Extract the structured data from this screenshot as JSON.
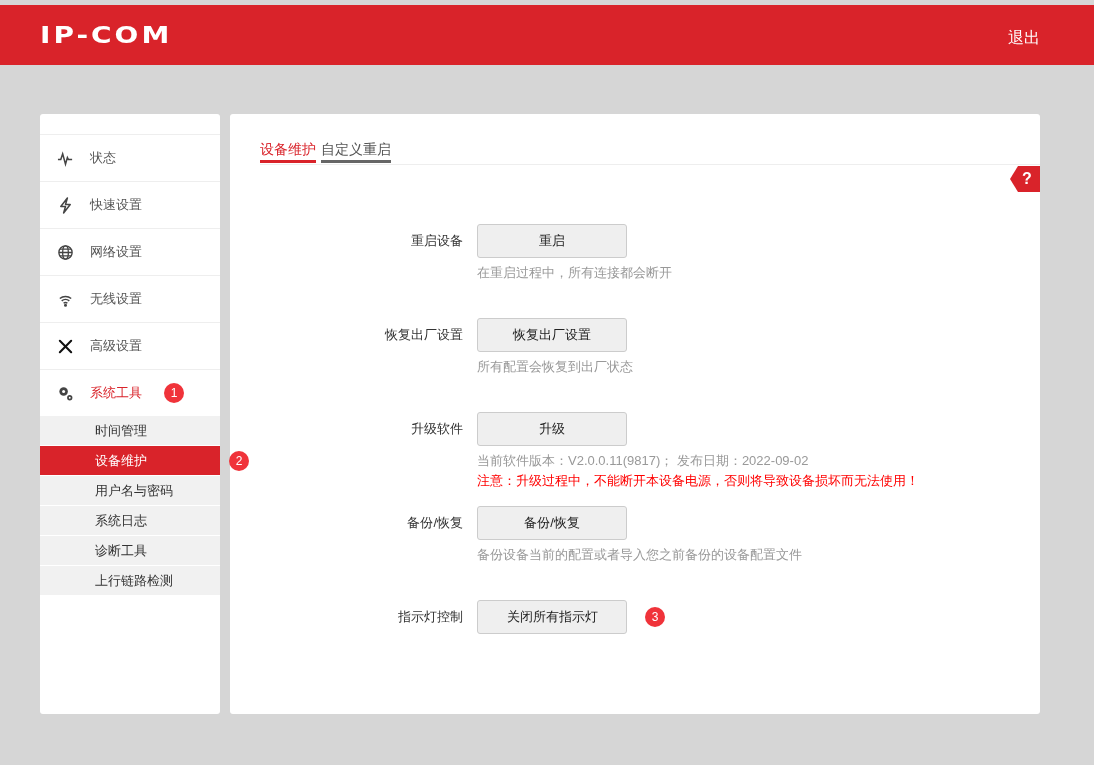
{
  "header": {
    "logo": "IP-COM",
    "logout": "退出"
  },
  "sidebar": {
    "items": [
      {
        "label": "状态",
        "selected": false
      },
      {
        "label": "快速设置",
        "selected": false
      },
      {
        "label": "网络设置",
        "selected": false
      },
      {
        "label": "无线设置",
        "selected": false
      },
      {
        "label": "高级设置",
        "selected": false
      },
      {
        "label": "系统工具",
        "selected": true,
        "marker": "1",
        "children": [
          {
            "label": "时间管理",
            "selected": false
          },
          {
            "label": "设备维护",
            "selected": true,
            "marker": "2"
          },
          {
            "label": "用户名与密码",
            "selected": false
          },
          {
            "label": "系统日志",
            "selected": false
          },
          {
            "label": "诊断工具",
            "selected": false
          },
          {
            "label": "上行链路检测",
            "selected": false
          }
        ]
      }
    ]
  },
  "tabs": [
    {
      "label": "设备维护",
      "selected": true
    },
    {
      "label": "自定义重启",
      "selected": false
    }
  ],
  "help": "?",
  "sections": [
    {
      "label": "重启设备",
      "button": "重启",
      "notes": [
        {
          "kind": "info",
          "text": "在重启过程中，所有连接都会断开"
        }
      ]
    },
    {
      "label": "恢复出厂设置",
      "button": "恢复出厂设置",
      "notes": [
        {
          "kind": "info",
          "text": "所有配置会恢复到出厂状态"
        }
      ]
    },
    {
      "label": "升级软件",
      "button": "升级",
      "notes": [
        {
          "kind": "info",
          "text": "当前软件版本：V2.0.0.11(9817)；  发布日期：2022-09-02"
        },
        {
          "kind": "warning",
          "text": "注意：升级过程中，不能断开本设备电源，否则将导致设备损坏而无法使用！"
        }
      ]
    },
    {
      "label": "备份/恢复",
      "button": "备份/恢复",
      "notes": [
        {
          "kind": "info",
          "text": "备份设备当前的配置或者导入您之前备份的设备配置文件"
        }
      ]
    },
    {
      "label": "指示灯控制",
      "button": "关闭所有指示灯",
      "marker": "3"
    }
  ]
}
